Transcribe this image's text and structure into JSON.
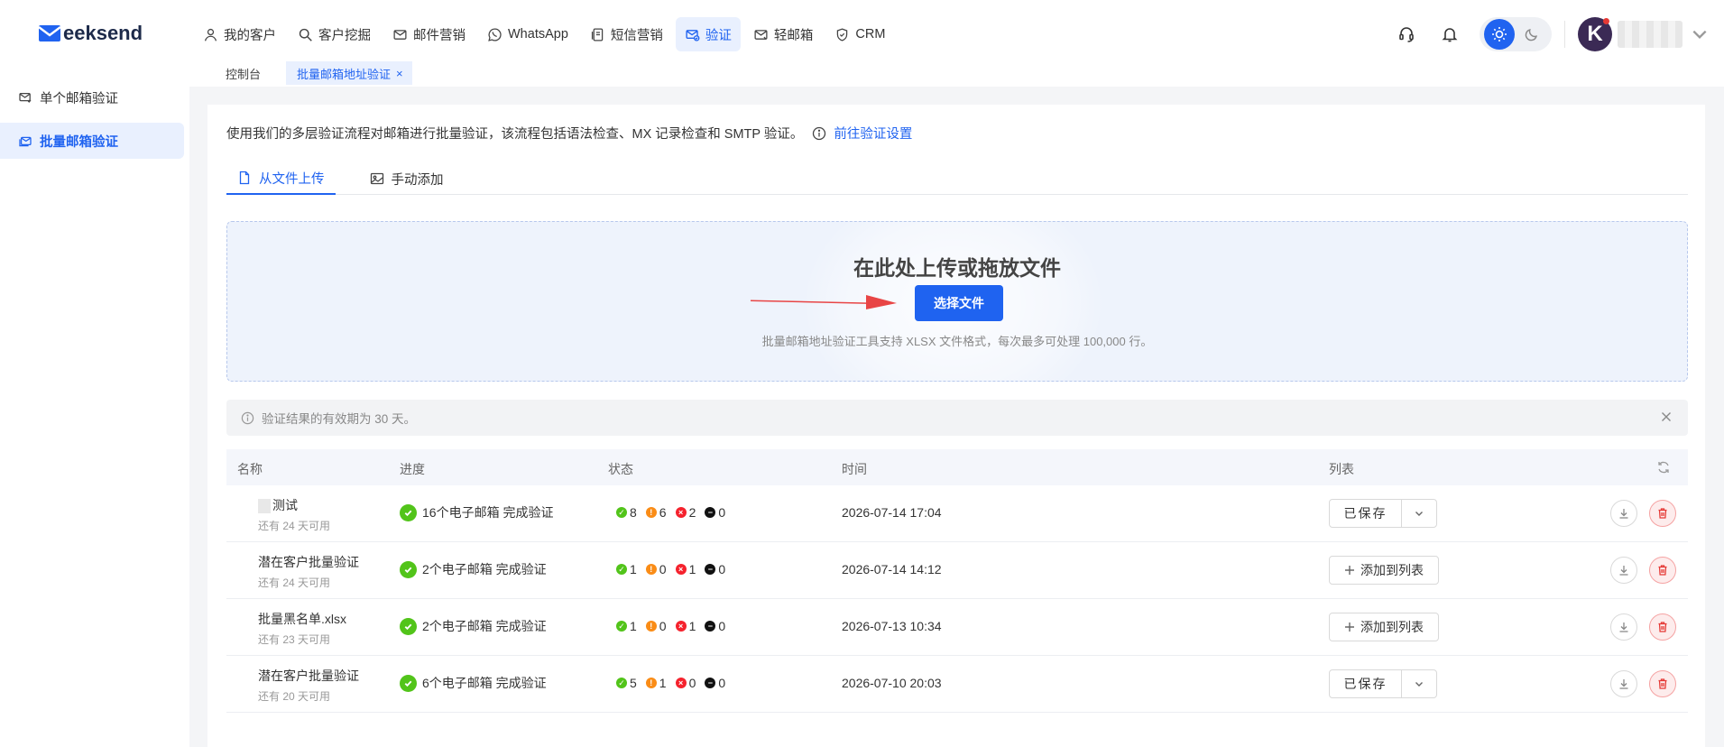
{
  "brand": {
    "name": "eeksend"
  },
  "nav": [
    {
      "label": "我的客户",
      "icon": "user-icon"
    },
    {
      "label": "客户挖掘",
      "icon": "search-icon"
    },
    {
      "label": "邮件营销",
      "icon": "mail-icon"
    },
    {
      "label": "WhatsApp",
      "icon": "whatsapp-icon"
    },
    {
      "label": "短信营销",
      "icon": "sms-icon"
    },
    {
      "label": "验证",
      "icon": "mail-check-icon",
      "active": true
    },
    {
      "label": "轻邮箱",
      "icon": "mail-light-icon"
    },
    {
      "label": "CRM",
      "icon": "shield-icon"
    }
  ],
  "user": {
    "avatar_letter": "K"
  },
  "page_tabs": {
    "home": "控制台",
    "current": "批量邮箱地址验证"
  },
  "sidebar": {
    "items": [
      {
        "label": "单个邮箱验证",
        "icon": "mail-icon"
      },
      {
        "label": "批量邮箱验证",
        "icon": "mail-stack-icon",
        "active": true
      }
    ]
  },
  "intro": {
    "text": "使用我们的多层验证流程对邮箱进行批量验证，该流程包括语法检查、MX 记录检查和 SMTP 验证。",
    "link": "前往验证设置"
  },
  "subtabs": {
    "upload": "从文件上传",
    "manual": "手动添加"
  },
  "dropzone": {
    "title": "在此处上传或拖放文件",
    "button": "选择文件",
    "hint": "批量邮箱地址验证工具支持 XLSX 文件格式，每次最多可处理 100,000 行。"
  },
  "notice": {
    "text": "验证结果的有效期为 30 天。"
  },
  "table": {
    "headers": {
      "name": "名称",
      "progress": "进度",
      "status": "状态",
      "time": "时间",
      "list": "列表"
    },
    "rows": [
      {
        "name": "测试",
        "sub": "还有 24 天可用",
        "progress": "16个电子邮箱 完成验证",
        "ok": "8",
        "warn": "6",
        "bad": "2",
        "unk": "0",
        "time": "2026-07-14 17:04",
        "action": "已保存"
      },
      {
        "name": "潜在客户批量验证",
        "sub": "还有 24 天可用",
        "progress": "2个电子邮箱 完成验证",
        "ok": "1",
        "warn": "0",
        "bad": "1",
        "unk": "0",
        "time": "2026-07-14 14:12",
        "action": "添加到列表"
      },
      {
        "name": "批量黑名单.xlsx",
        "sub": "还有 23 天可用",
        "progress": "2个电子邮箱 完成验证",
        "ok": "1",
        "warn": "0",
        "bad": "1",
        "unk": "0",
        "time": "2026-07-13 10:34",
        "action": "添加到列表"
      },
      {
        "name": "潜在客户批量验证",
        "sub": "还有 20 天可用",
        "progress": "6个电子邮箱 完成验证",
        "ok": "5",
        "warn": "1",
        "bad": "0",
        "unk": "0",
        "time": "2026-07-10 20:03",
        "action": "已保存"
      }
    ]
  },
  "colors": {
    "primary": "#2063f0",
    "success": "#52c41a",
    "warning": "#fa8c16",
    "danger": "#f5222d",
    "arrow": "#e84545"
  }
}
